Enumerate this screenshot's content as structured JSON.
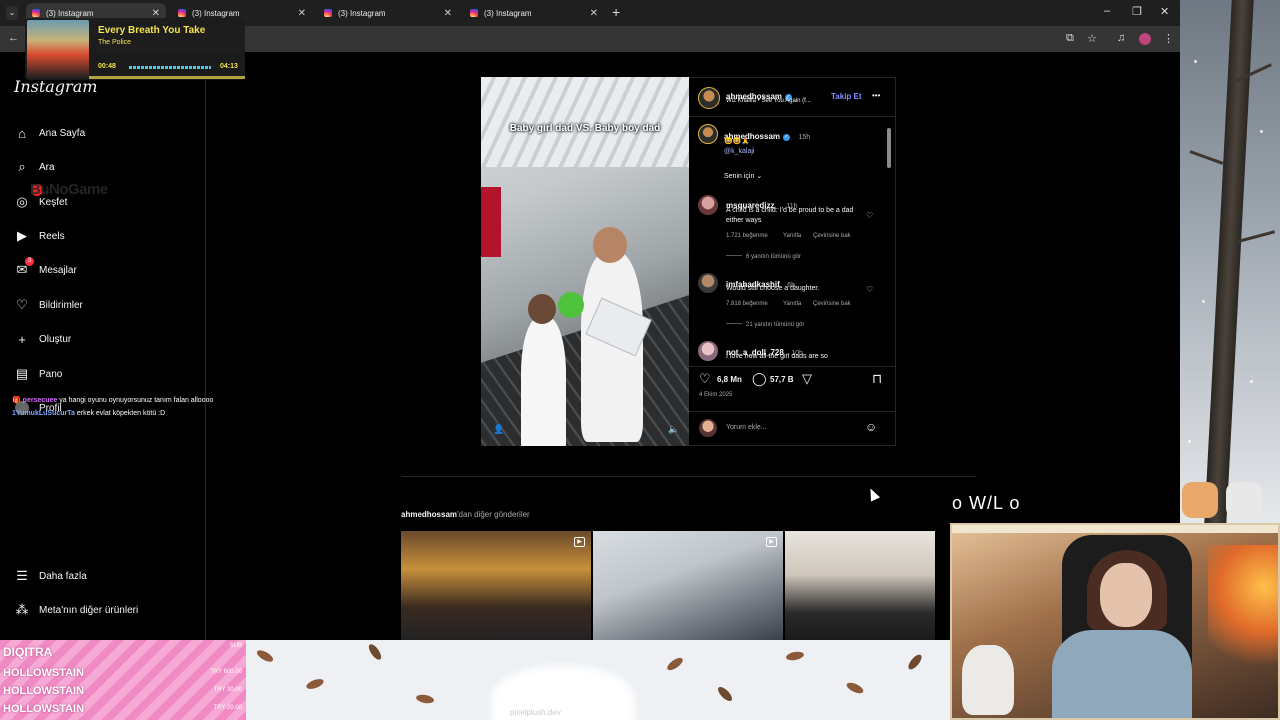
{
  "browser": {
    "tabs": [
      {
        "label": "(3) Instagram",
        "active": true
      },
      {
        "label": "(3) Instagram",
        "active": false
      },
      {
        "label": "(3) Instagram",
        "active": false
      },
      {
        "label": "(3) Instagram",
        "active": false
      }
    ],
    "new_tab": "+",
    "window_controls": [
      "–",
      "❐",
      "✕"
    ]
  },
  "music_widget": {
    "title": "Every Breath You Take",
    "artist": "The Police",
    "elapsed": "00:48",
    "duration": "04:13",
    "progress": 0.19
  },
  "sidebar": {
    "logo": "Instagram",
    "items": [
      {
        "label": "Ana Sayfa",
        "icon": "home-icon"
      },
      {
        "label": "Ara",
        "icon": "search-icon"
      },
      {
        "label": "Keşfet",
        "icon": "compass-icon"
      },
      {
        "label": "Reels",
        "icon": "reels-icon"
      },
      {
        "label": "Mesajlar",
        "icon": "messenger-icon",
        "badge": "3"
      },
      {
        "label": "Bildirimler",
        "icon": "heart-icon"
      },
      {
        "label": "Oluştur",
        "icon": "plus-icon"
      },
      {
        "label": "Pano",
        "icon": "chart-icon"
      },
      {
        "label": "Profil",
        "icon": "avatar-icon"
      }
    ],
    "more": "Daha fazla",
    "meta": "Meta'nın diğer ürünleri"
  },
  "overlay_watermark": "BuNoGame",
  "chat": [
    {
      "user": "persecuee",
      "text": "ya hangi oyunu oynuyorsunuz tanım falan alloooo"
    },
    {
      "user": "1YumukLuSucurTa",
      "text": "erkek evlat köpekten kötü :D"
    }
  ],
  "post": {
    "video_caption": "Baby girl dad VS. Baby boy dad",
    "author": "ahmedhossam",
    "audio": "Wiz Khalifa • See You Again (f...",
    "follow": "Takip Et",
    "menu": "•••",
    "caption_user": "ahmedhossam",
    "caption_time": "15h",
    "caption_emojis": "😆😆🙏",
    "caption_mention": "@k_kalaji",
    "for_you": "Senin için",
    "comments": [
      {
        "user": "msquaredizz_",
        "time": "11h",
        "text": "A child is a child. I'd be proud to be a dad either ways",
        "likes": "1.721 beğenme",
        "reply": "Yanıtla",
        "translate": "Çevirisine bak",
        "view_replies": "6 yanıtın tümünü gör"
      },
      {
        "user": "imfahadkashif",
        "time": "6h",
        "text": "Would still choose a daughter.",
        "likes": "7.818 beğenme",
        "reply": "Yanıtla",
        "translate": "Çevirisine bak",
        "view_replies": "21 yanıtın tümünü gör"
      },
      {
        "user": "not_a_doll_728",
        "time": "10h",
        "text": "I love how all the girl dads are so",
        "likes": "",
        "reply": "",
        "translate": "",
        "view_replies": ""
      }
    ],
    "like_count": "6,8 Mn",
    "comment_count": "57,7 B",
    "date": "4 Ekim 2025",
    "add_comment": "Yorum ekle..."
  },
  "more_posts": {
    "user": "ahmedhossam",
    "suffix": "'dan diğer gönderiler"
  },
  "stream": {
    "wl": "o W/L o",
    "subs_header": "DIQITRA",
    "subs_tag": "SUB",
    "subs": [
      {
        "name": "HOLLOWSTAIN",
        "amount": "TRY 600.00"
      },
      {
        "name": "HOLLOWSTAIN",
        "amount": "TRY 30.00"
      },
      {
        "name": "HOLLOWSTAIN",
        "amount": "TRY 20.00"
      }
    ],
    "credit": "pixelplush.dev"
  }
}
